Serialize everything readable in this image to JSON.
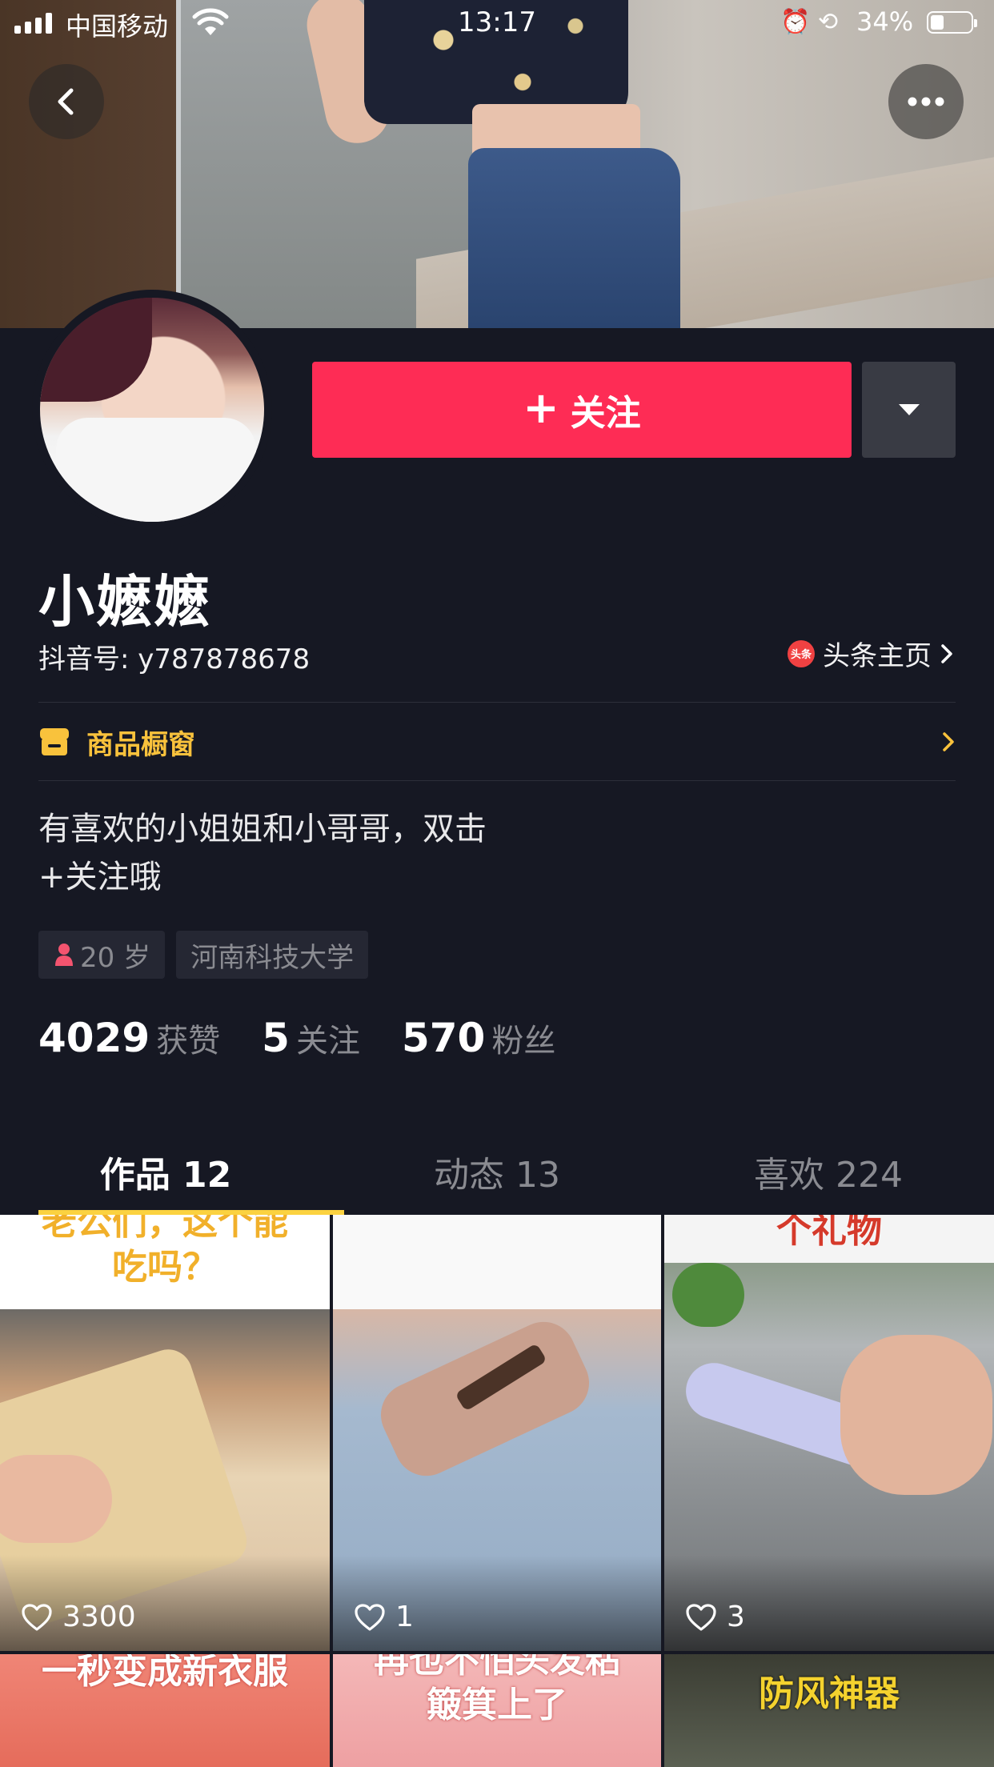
{
  "status_bar": {
    "carrier": "中国移动",
    "time": "13:17",
    "battery_pct": "34%",
    "battery_level": 0.34
  },
  "profile": {
    "follow_label": "关注",
    "nickname": "小嬷嬷",
    "douyin_id": "抖音号: y787878678",
    "toutiao_label": "头条主页",
    "toutiao_icon_text": "头条",
    "shop_label": "商品橱窗",
    "bio_line1": "有喜欢的小姐姐和小哥哥，双击",
    "bio_line2": "+关注哦",
    "tags": [
      "20 岁",
      "河南科技大学"
    ]
  },
  "stats": [
    {
      "num": "4029",
      "label": "获赞"
    },
    {
      "num": "5",
      "label": "关注"
    },
    {
      "num": "570",
      "label": "粉丝"
    }
  ],
  "tabs": [
    {
      "label": "作品 12",
      "active": true
    },
    {
      "label": "动态 13",
      "active": false
    },
    {
      "label": "喜欢 224",
      "active": false
    }
  ],
  "videos": [
    {
      "caption": "老公们，这个能\n吃吗？",
      "likes": "3300"
    },
    {
      "caption": "",
      "likes": "1"
    },
    {
      "caption": "个礼物",
      "likes": "3"
    },
    {
      "caption": "一秒变成新衣服",
      "likes": ""
    },
    {
      "caption": "再也不怕头发粘\n簸箕上了",
      "likes": ""
    },
    {
      "caption": "防风神器",
      "likes": ""
    }
  ],
  "colors": {
    "background": "#161823",
    "follow_button": "#fe2c55",
    "shop_accent": "#f9c23c",
    "tab_indicator": "#fbd240"
  }
}
